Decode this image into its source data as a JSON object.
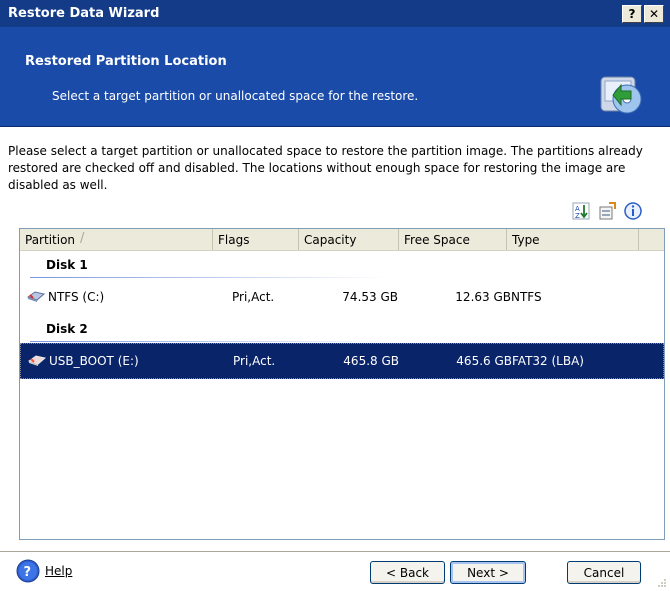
{
  "window": {
    "title": "Restore Data Wizard",
    "help_button": "?",
    "close_button": "✕"
  },
  "header": {
    "title": "Restored Partition Location",
    "subtitle": "Select a target partition or unallocated space for the restore."
  },
  "instructions": "Please select a target partition or unallocated space to restore the partition image. The partitions already restored are checked off and disabled. The locations without enough space for restoring the image are disabled as well.",
  "toolbar": {
    "icons": [
      "sort-icon",
      "properties-icon",
      "info-icon"
    ]
  },
  "list": {
    "columns": [
      "Partition",
      "Flags",
      "Capacity",
      "Free Space",
      "Type"
    ],
    "groups": [
      {
        "label": "Disk 1",
        "items": [
          {
            "partition": "NTFS (C:)",
            "flags": "Pri,Act.",
            "capacity": "74.53 GB",
            "free": "12.63 GB",
            "type": "NTFS",
            "selected": false
          }
        ]
      },
      {
        "label": "Disk 2",
        "items": [
          {
            "partition": "USB_BOOT (E:)",
            "flags": "Pri,Act.",
            "capacity": "465.8 GB",
            "free": "465.6 GB",
            "type": "FAT32 (LBA)",
            "selected": true
          }
        ]
      }
    ]
  },
  "footer": {
    "help_label": "Help",
    "back_label": "< Back",
    "next_label": "Next >",
    "cancel_label": "Cancel"
  },
  "colors": {
    "titlebar": "#133b87",
    "header": "#1a4ba8",
    "selection": "#0a246a"
  }
}
